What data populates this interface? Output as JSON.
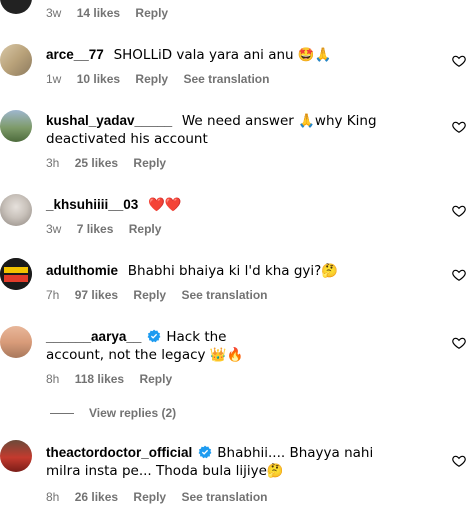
{
  "comments": [
    {
      "username": "",
      "text": "",
      "time": "3w",
      "likes": "14 likes",
      "reply": "Reply",
      "translation": ""
    },
    {
      "username": "arce__77",
      "text": "SHOLLiD vala yara ani anu 🤩🙏",
      "time": "1w",
      "likes": "10 likes",
      "reply": "Reply",
      "translation": "See translation"
    },
    {
      "username": "kushal_yadav_____",
      "text": "We need answer 🙏why King deactivated his account",
      "time": "3h",
      "likes": "25 likes",
      "reply": "Reply",
      "translation": ""
    },
    {
      "username": "_khsuhiiii__03",
      "text": "❤️❤️",
      "time": "3w",
      "likes": "7 likes",
      "reply": "Reply",
      "translation": ""
    },
    {
      "username": "adulthomie",
      "text": "Bhabhi bhaiya ki l'd kha gyi?🤔",
      "time": "7h",
      "likes": "97 likes",
      "reply": "Reply",
      "translation": "See translation"
    },
    {
      "username": "______aarya__",
      "text": "Hack the account, not the legacy 👑🔥",
      "time": "8h",
      "likes": "118 likes",
      "reply": "Reply",
      "translation": ""
    },
    {
      "username": "theactordoctor_official",
      "text": "Bhabhii.... Bhayya nahi milra insta pe... Thoda bula lijiye🤔",
      "time": "8h",
      "likes": "26 likes",
      "reply": "Reply",
      "translation": "See translation"
    }
  ],
  "view_replies": "View replies (2)"
}
